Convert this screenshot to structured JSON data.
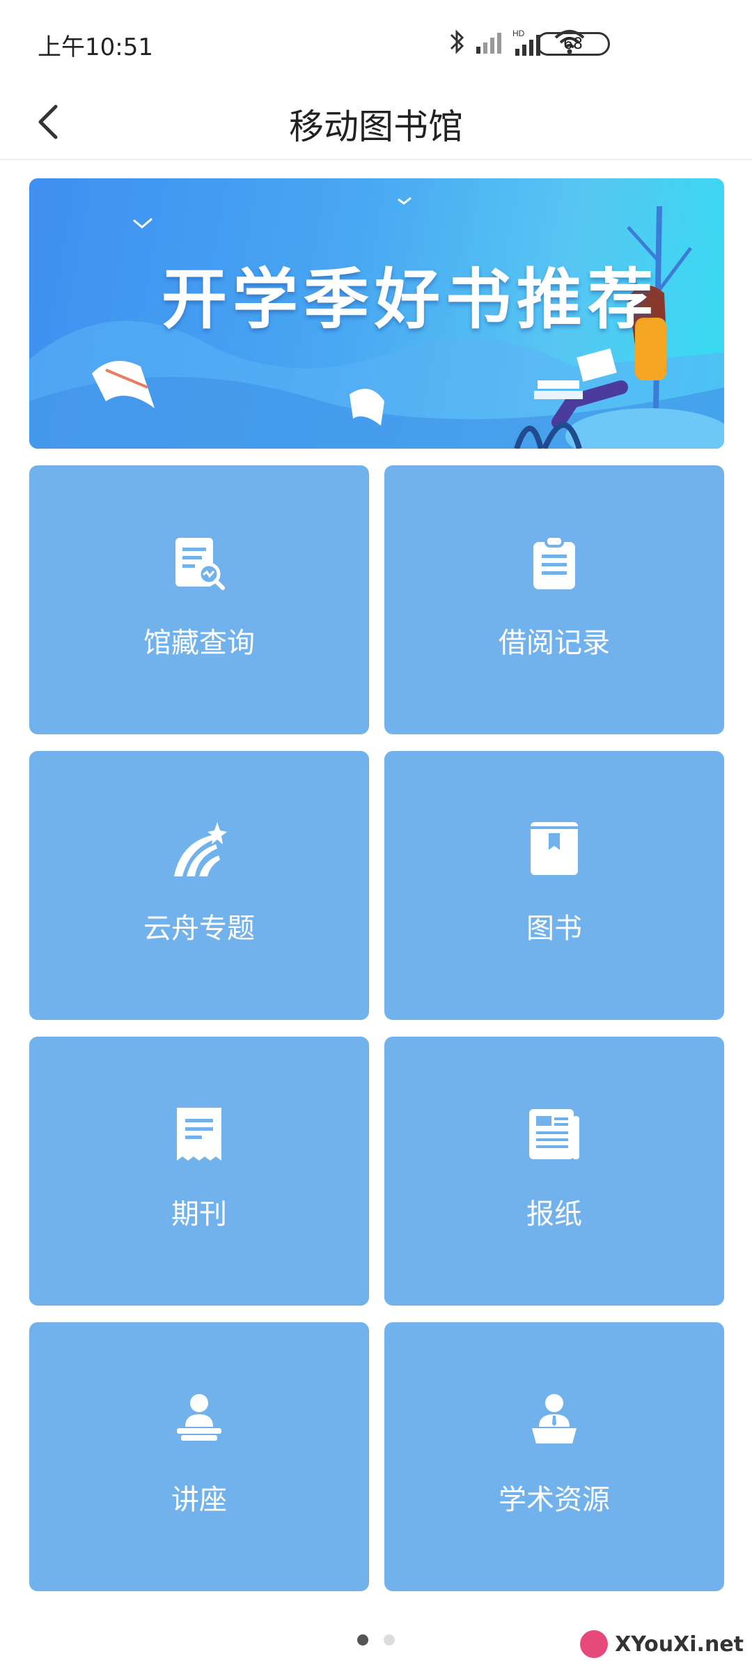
{
  "status_bar": {
    "time": "上午10:51",
    "battery": "68",
    "icons": [
      "bluetooth-icon",
      "signal-icon",
      "hd-signal-icon",
      "wifi-icon"
    ]
  },
  "nav": {
    "title": "移动图书馆",
    "back_icon": "back-arrow-icon"
  },
  "banner": {
    "text": "开学季好书推荐"
  },
  "tiles": [
    {
      "label": "馆藏查询",
      "icon": "document-search-icon"
    },
    {
      "label": "借阅记录",
      "icon": "clipboard-icon"
    },
    {
      "label": "云舟专题",
      "icon": "shooting-star-icon"
    },
    {
      "label": "图书",
      "icon": "book-bookmark-icon"
    },
    {
      "label": "期刊",
      "icon": "receipt-icon"
    },
    {
      "label": "报纸",
      "icon": "newspaper-icon"
    },
    {
      "label": "讲座",
      "icon": "lecture-speaker-icon"
    },
    {
      "label": "学术资源",
      "icon": "presenter-icon"
    }
  ],
  "pagination": {
    "current": 1,
    "total": 2
  },
  "watermark": {
    "text": "XYouXi.net"
  },
  "colors": {
    "tile": "#72b2ec",
    "banner_start": "#3f8ff0",
    "banner_end": "#36dcf1"
  }
}
